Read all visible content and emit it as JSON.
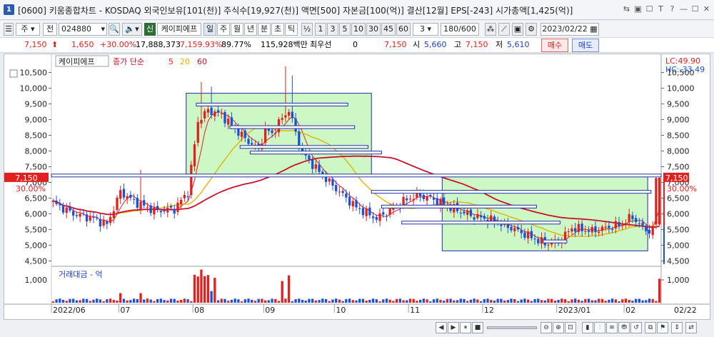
{
  "window": {
    "number": "1",
    "title": "[0600] 키움종합차트 - KOSDAQ 외국인보유[101(천)] 주식수[19,927(천)] 액면[500] 자본금[100(억)] 결산[12월] EPS[-243] 시가총액[1,425(억)]",
    "controls": [
      "⇆",
      "▣",
      "☐",
      "T",
      "?",
      "—",
      "☐",
      "✕"
    ]
  },
  "toolbar": {
    "market_select": "주",
    "type_select": "전",
    "code": "024880",
    "stock_name": "케이피에프",
    "new_label": "신",
    "periods": [
      "일",
      "주",
      "월",
      "년",
      "분",
      "초",
      "틱"
    ],
    "active_period": "일",
    "fraction": "½",
    "minutes": [
      "1",
      "3",
      "5",
      "10",
      "30",
      "45",
      "60"
    ],
    "count_select": "3",
    "bars_view": "180/600",
    "date": "2023/02/22"
  },
  "quote": {
    "price": "7,150",
    "arrow": "⬆",
    "change": "1,650",
    "change_pct": "+30.00%",
    "volume": "17,888,373",
    "volume_pct": "7,159.93%",
    "turnover": "89.77%",
    "amount": "115,928백만",
    "preferred_label": "최우선",
    "preferred_value": "0",
    "current": "7,150",
    "open_label": "시",
    "open": "5,660",
    "high_label": "고",
    "high": "7,150",
    "low_label": "저",
    "low": "5,610",
    "buy_label": "매수",
    "sell_label": "매도"
  },
  "chart_data": {
    "type": "candlestick",
    "stock_label": "케이피에프",
    "indicator_label": "종가 단순",
    "ma_periods": [
      "5",
      "20",
      "60"
    ],
    "ma_colors": {
      "5": "#e0211f",
      "20": "#e3b300",
      "60": "#c8102e"
    },
    "lc_label": "LC:49.90",
    "hc_label": "HC:-33.49",
    "price_marker": "7,150",
    "pct_marker": "30.00%",
    "y_ticks": [
      "10,500",
      "10,000",
      "9,500",
      "9,000",
      "8,500",
      "8,000",
      "7,500",
      "7,000",
      "6,500",
      "6,000",
      "5,500",
      "5,000",
      "4,500"
    ],
    "y_values": [
      10500,
      10000,
      9500,
      9000,
      8500,
      8000,
      7500,
      7000,
      6500,
      6000,
      5500,
      5000,
      4500
    ],
    "ylim": [
      4350,
      10900
    ],
    "x_labels": [
      "2022/06",
      "07",
      "08",
      "09",
      "10",
      "11",
      "12",
      "2023/01",
      "02"
    ],
    "current_date_label": "02/22",
    "boxes": [
      {
        "from": 40,
        "to": 95,
        "low": 7220,
        "high": 9840
      },
      {
        "from": 116,
        "to": 177,
        "low": 4820,
        "high": 7220
      }
    ],
    "levels": [
      {
        "from": 43,
        "to": 87,
        "value": 9480
      },
      {
        "from": 53,
        "to": 89,
        "value": 8760
      },
      {
        "from": 56,
        "to": 93,
        "value": 8130
      },
      {
        "from": 59,
        "to": 97,
        "value": 7950
      },
      {
        "from": 0,
        "to": 180,
        "value": 7220
      },
      {
        "from": 95,
        "to": 177,
        "value": 6700
      },
      {
        "from": 98,
        "to": 143,
        "value": 6230
      },
      {
        "from": 104,
        "to": 150,
        "value": 5720
      },
      {
        "from": 146,
        "to": 152,
        "value": 5120
      }
    ],
    "volume_label": "거래대금 - 억",
    "volume_ticks": [
      "1,000"
    ],
    "volume_tick_values": [
      1000
    ],
    "volume_ylim": [
      0,
      1500
    ]
  },
  "status": {
    "buttons": [
      "◀",
      "▶",
      "⏸",
      "■",
      "▶"
    ],
    "zoom_label": "▭─"
  }
}
